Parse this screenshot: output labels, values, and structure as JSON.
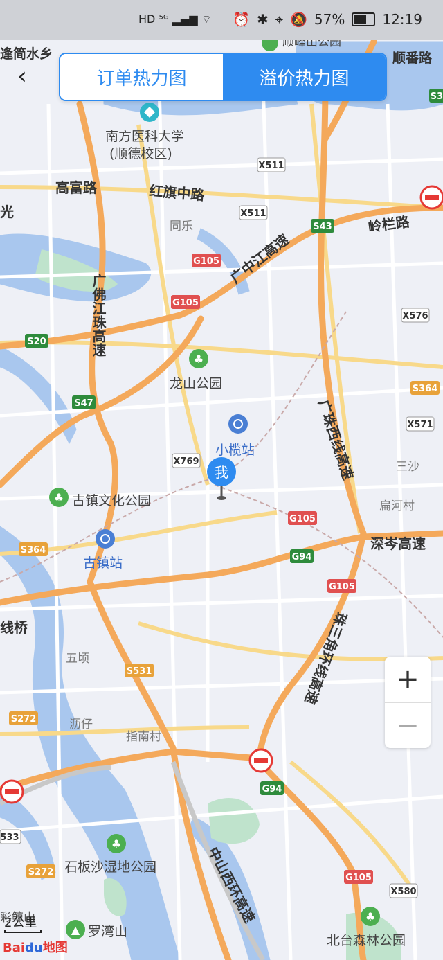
{
  "status_bar": {
    "left_icons": "HD ⁵ᴳ ▂▄▆ ⌔",
    "battery": "57%",
    "time": "12:19",
    "icons": [
      "alarm-icon",
      "bluetooth-icon",
      "location-icon",
      "mute-icon"
    ]
  },
  "tabs": [
    "订单热力图",
    "溢价热力图"
  ],
  "active_tab": 1,
  "map": {
    "place_labels": [
      "南方医科大学",
      "(顺德校区)",
      "同乐",
      "龙山公园",
      "小榄站",
      "古镇文化公园",
      "古镇站",
      "三沙",
      "扁河村",
      "五顷",
      "沥仔",
      "指南村",
      "石板沙湿地公园",
      "罗湾山",
      "北台森林公园",
      "顺峰山公园",
      "逢简水乡",
      "顺番路",
      "高富路",
      "红旗中路",
      "岭栏路",
      "深岑高速",
      "光",
      "线桥",
      "彩鲸山"
    ],
    "highway_labels": [
      "广中江高速",
      "广佛江珠高速",
      "广珠西线高速",
      "珠三角环线高速",
      "中山西环高速"
    ],
    "road_shields": {
      "green": [
        "S43",
        "S20",
        "S47",
        "G94",
        "G94",
        "S3"
      ],
      "red": [
        "G105",
        "G105",
        "G105",
        "G105",
        "G105"
      ],
      "yellow": [
        "S364",
        "S364",
        "S531",
        "S272",
        "S272"
      ],
      "white": [
        "X511",
        "X511",
        "X769",
        "X576",
        "X571",
        "X580",
        "533"
      ]
    },
    "my_location_label": "我"
  },
  "zoom": {
    "in": "+",
    "out": "−"
  },
  "scale": "2公里",
  "logo": {
    "brand": "Bai",
    "du": "du",
    "suffix": "地图"
  },
  "colors": {
    "accent": "#2e8bf0",
    "highway": "#f4a95b",
    "water": "#a9c7ee",
    "park": "#bfe3cc",
    "background": "#eef0f6"
  }
}
